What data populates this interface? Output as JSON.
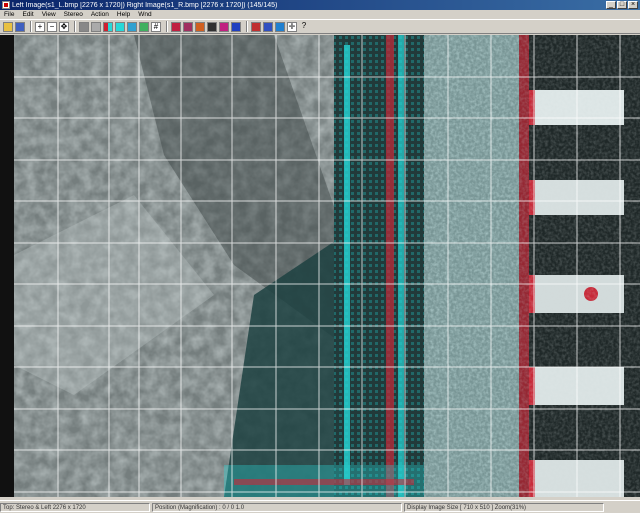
{
  "window": {
    "title": "Left Image(s1_L.bmp [2276 x 1720]) Right Image(s1_R.bmp [2276 x 1720]) (145/145)"
  },
  "menu": [
    "File",
    "Edit",
    "View",
    "Stereo",
    "Action",
    "Help",
    "Wnd"
  ],
  "toolbar": {
    "help_label": "?"
  },
  "statusbar": {
    "left": "Top: Stereo & Left 2276 x 1720",
    "middle": "Position (Magnification) : 0 / 0 1.0",
    "right": "Display Image Size [ 710 x 510 ] Zoom(31%)"
  },
  "colors": {
    "cyan": "#27d8d8",
    "red": "#d02030",
    "grid": "#ffffff"
  }
}
